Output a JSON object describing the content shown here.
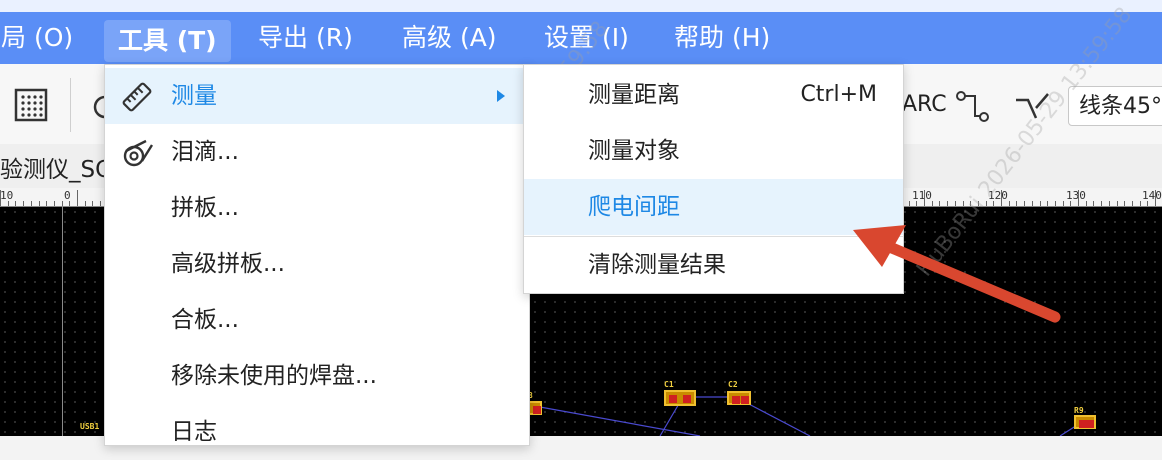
{
  "menubar": {
    "items": [
      {
        "label": "布局 (O)"
      },
      {
        "label": "工具 (T)"
      },
      {
        "label": "导出 (R)"
      },
      {
        "label": "高级 (A)"
      },
      {
        "label": "设置 (I)"
      },
      {
        "label": "帮助 (H)"
      }
    ]
  },
  "toolbar": {
    "text_tool_label": "ARC",
    "line_style": "线条45°"
  },
  "document_tab": {
    "title": "验测仪_SC"
  },
  "ruler": {
    "labels": [
      "10",
      "0",
      "110",
      "120",
      "130",
      "140"
    ]
  },
  "tools_menu": {
    "items": [
      {
        "label": "测量",
        "icon": "ruler-icon"
      },
      {
        "label": "泪滴...",
        "icon": "teardrop-icon"
      },
      {
        "label": "拼板..."
      },
      {
        "label": "高级拼板..."
      },
      {
        "label": "合板..."
      },
      {
        "label": "移除未使用的焊盘..."
      },
      {
        "label": "日志"
      }
    ]
  },
  "measure_submenu": {
    "items": [
      {
        "label": "测量距离",
        "shortcut": "Ctrl+M"
      },
      {
        "label": "测量对象"
      },
      {
        "label": "爬电间距"
      },
      {
        "label": "清除测量结果"
      }
    ]
  },
  "watermark": {
    "text": "HuBoRui 2026-05-29 13:59:58"
  },
  "pcb": {
    "refs": [
      "C1",
      "C2",
      "R9",
      "USB1"
    ]
  },
  "colors": {
    "menubar": "#5a8ef6",
    "highlight": "#e6f3fd",
    "accent": "#1e88e5",
    "annotation_arrow": "#d9472f"
  }
}
